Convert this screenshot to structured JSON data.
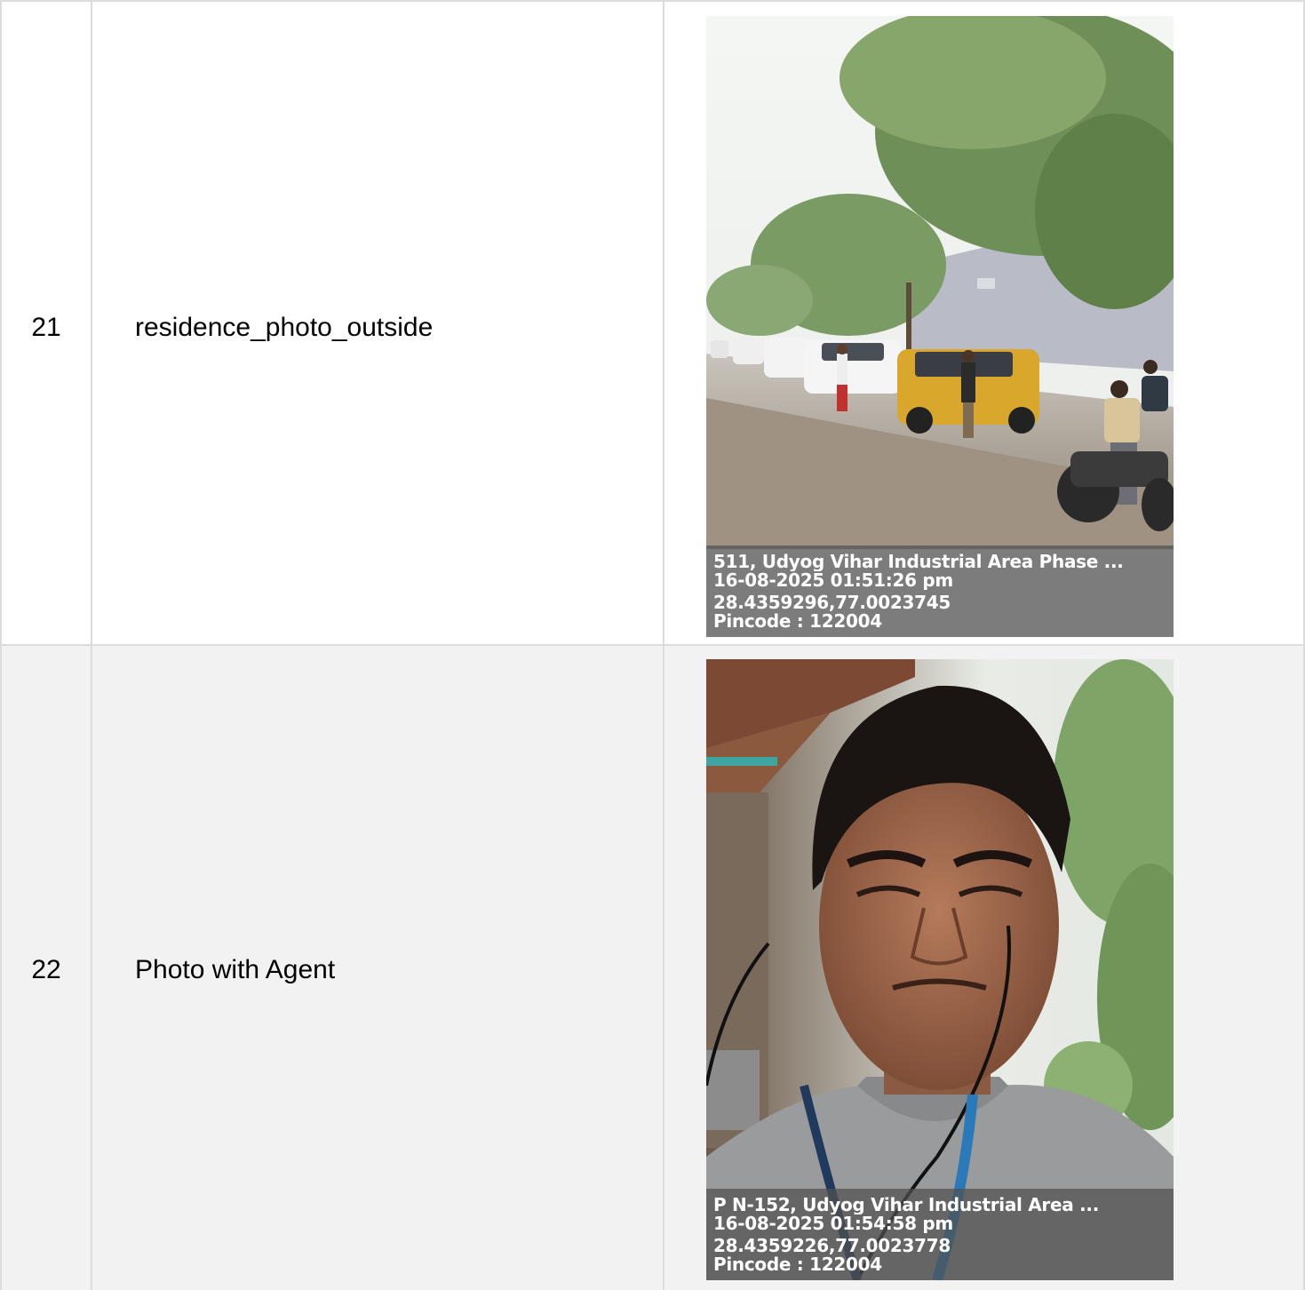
{
  "rows": [
    {
      "index": "21",
      "label": "residence_photo_outside",
      "photo": {
        "description_icon": "street-scene-photo",
        "caption": {
          "address": "511, Udyog Vihar Industrial Area Phase ...",
          "datetime": "16-08-2025 01:51:26 pm",
          "coordinates": "28.4359296,77.0023745",
          "pincode": "Pincode : 122004"
        }
      }
    },
    {
      "index": "22",
      "label": "Photo with Agent",
      "photo": {
        "description_icon": "selfie-portrait-photo",
        "caption": {
          "address": "P N-152, Udyog Vihar Industrial Area ...",
          "datetime": "16-08-2025 01:54:58 pm",
          "coordinates": "28.4359226,77.0023778",
          "pincode": "Pincode : 122004"
        }
      }
    }
  ]
}
